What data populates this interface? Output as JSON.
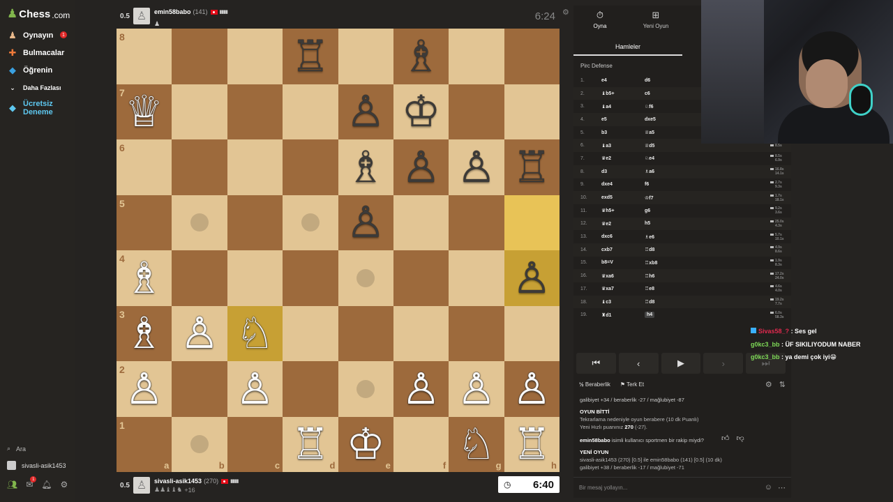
{
  "sidebar": {
    "logo_text": "Chess",
    "logo_suffix": ".com",
    "items": [
      {
        "label": "Oynayın",
        "icon": "play-icon",
        "badge": "1"
      },
      {
        "label": "Bulmacalar",
        "icon": "puzzle-icon"
      },
      {
        "label": "Öğrenin",
        "icon": "learn-icon"
      },
      {
        "label": "Daha Fazlası",
        "icon": "chevron-down-icon"
      },
      {
        "label": "Ücretsiz Deneme",
        "icon": "diamond-icon"
      }
    ],
    "search_label": "Ara",
    "user": "sivasli-asik1453",
    "mail_badge": "1"
  },
  "top_player": {
    "score": "0.5",
    "name": "emin58babo",
    "rating": "(141)",
    "clock": "6:24",
    "sub": "♟"
  },
  "bottom_player": {
    "score": "0.5",
    "name": "sivasli-asik1453",
    "rating": "(270)",
    "clock": "6:40",
    "captures": "+16"
  },
  "board": {
    "ranks": [
      "8",
      "7",
      "6",
      "5",
      "4",
      "3",
      "2",
      "1"
    ],
    "files": [
      "a",
      "b",
      "c",
      "d",
      "e",
      "f",
      "g",
      "h"
    ],
    "rows": [
      [
        "",
        "",
        "",
        "r",
        "",
        "b",
        "",
        ""
      ],
      [
        "Q",
        "",
        "",
        "",
        "p",
        "k",
        "",
        ""
      ],
      [
        "",
        "",
        "",
        "",
        "b",
        "p",
        "p",
        "r"
      ],
      [
        "",
        "",
        "",
        "",
        "p",
        "",
        "",
        ""
      ],
      [
        "B",
        "",
        "",
        "",
        "",
        "",
        "",
        "p"
      ],
      [
        "B",
        "P",
        "N",
        "",
        "",
        "",
        "",
        ""
      ],
      [
        "P",
        "",
        "P",
        "",
        "",
        "P",
        "P",
        "P"
      ],
      [
        "",
        "",
        "",
        "R",
        "K",
        "",
        "N",
        "R"
      ]
    ],
    "highlights": [
      "h5",
      "h4",
      "c3"
    ],
    "dots": [
      "b5",
      "d5",
      "e4",
      "e2",
      "b1"
    ]
  },
  "panel": {
    "tab_play": "Oyna",
    "tab_new": "Yeni Oyun",
    "moves_tab": "Hamleler",
    "opening": "Pirc Defense",
    "moves": [
      {
        "n": "1.",
        "w": "e4",
        "b": "d6",
        "t1": "",
        "t2": ""
      },
      {
        "n": "2.",
        "w": "♝b5+",
        "b": "c6",
        "t1": "",
        "t2": ""
      },
      {
        "n": "3.",
        "w": "♝a4",
        "b": "♘f6",
        "t1": "",
        "t2": ""
      },
      {
        "n": "4.",
        "w": "e5",
        "b": "dxe5",
        "t1": "",
        "t2": ""
      },
      {
        "n": "5.",
        "w": "b3",
        "b": "♕a5",
        "t1": "",
        "t2": ""
      },
      {
        "n": "6.",
        "w": "♝a3",
        "b": "♕d5",
        "t1": "8.5s",
        "t2": ""
      },
      {
        "n": "7.",
        "w": "♛e2",
        "b": "♘e4",
        "t1": "8.5s",
        "t2": "6.9s"
      },
      {
        "n": "8.",
        "w": "d3",
        "b": "♗a6",
        "t1": "16.8s",
        "t2": "14.1s"
      },
      {
        "n": "9.",
        "w": "dxe4",
        "b": "f6",
        "t1": "2.7s",
        "t2": "9.3s"
      },
      {
        "n": "10.",
        "w": "exd5",
        "b": "♔f7",
        "t1": "1.7s",
        "t2": "18.1s"
      },
      {
        "n": "11.",
        "w": "♛h5+",
        "b": "g6",
        "t1": "9.2s",
        "t2": "3.6s"
      },
      {
        "n": "12.",
        "w": "♛e2",
        "b": "h5",
        "t1": "25.0s",
        "t2": "4.3s"
      },
      {
        "n": "13.",
        "w": "dxc6",
        "b": "♗e6",
        "t1": "5.7s",
        "t2": "10.1s"
      },
      {
        "n": "14.",
        "w": "cxb7",
        "b": "♖d8",
        "t1": "4.9s",
        "t2": "8.6s"
      },
      {
        "n": "15.",
        "w": "b8=V",
        "b": "♖xb8",
        "t1": "1.9s",
        "t2": "8.3s"
      },
      {
        "n": "16.",
        "w": "♛xa6",
        "b": "♖h6",
        "t1": "17.2s",
        "t2": "24.0s"
      },
      {
        "n": "17.",
        "w": "♛xa7",
        "b": "♖e8",
        "t1": "4.6s",
        "t2": "4.0s"
      },
      {
        "n": "18.",
        "w": "♝c3",
        "b": "♖d8",
        "t1": "19.2s",
        "t2": "7.7s"
      },
      {
        "n": "19.",
        "w": "♜d1",
        "b": "h4",
        "t1": "6.0s",
        "t2": "58.3s"
      }
    ],
    "draw_label": "Beraberlik",
    "resign_label": "Terk Et",
    "stats_line1": "galibiyet +34 / beraberlik -27 / mağlubiyet -87",
    "game_over_title": "OYUN BİTTİ",
    "game_over_reason": "Tekrarlama nedeniyle oyun berabere (10 dk Puanlı)",
    "new_rating_prefix": "Yeni Hızlı puanınız",
    "new_rating_value": "270",
    "new_rating_delta": "(-27).",
    "chat_user": "emin58babo",
    "chat_msg": "isimli kullanıcı sportmen bir rakip miydi?",
    "new_game_title": "YENİ OYUN",
    "new_game_line": "sivasli-asik1453 (270) [0.5] ile emin58babo (141) [0.5] (10 dk)",
    "stats_line2": "galibiyet +38 / beraberlik -17 / mağlubiyet -71",
    "chat_placeholder": "Bir mesaj yollayın..."
  },
  "stream_chat": [
    {
      "user": "Sivas58_?",
      "msg": ": Ses gel"
    },
    {
      "user": "g0kc3_bb",
      "msg": ": ÜF SIKILIYODUM NABER"
    },
    {
      "user": "g0kc3_bb",
      "msg": ": ya demi çok iyi😁"
    }
  ]
}
